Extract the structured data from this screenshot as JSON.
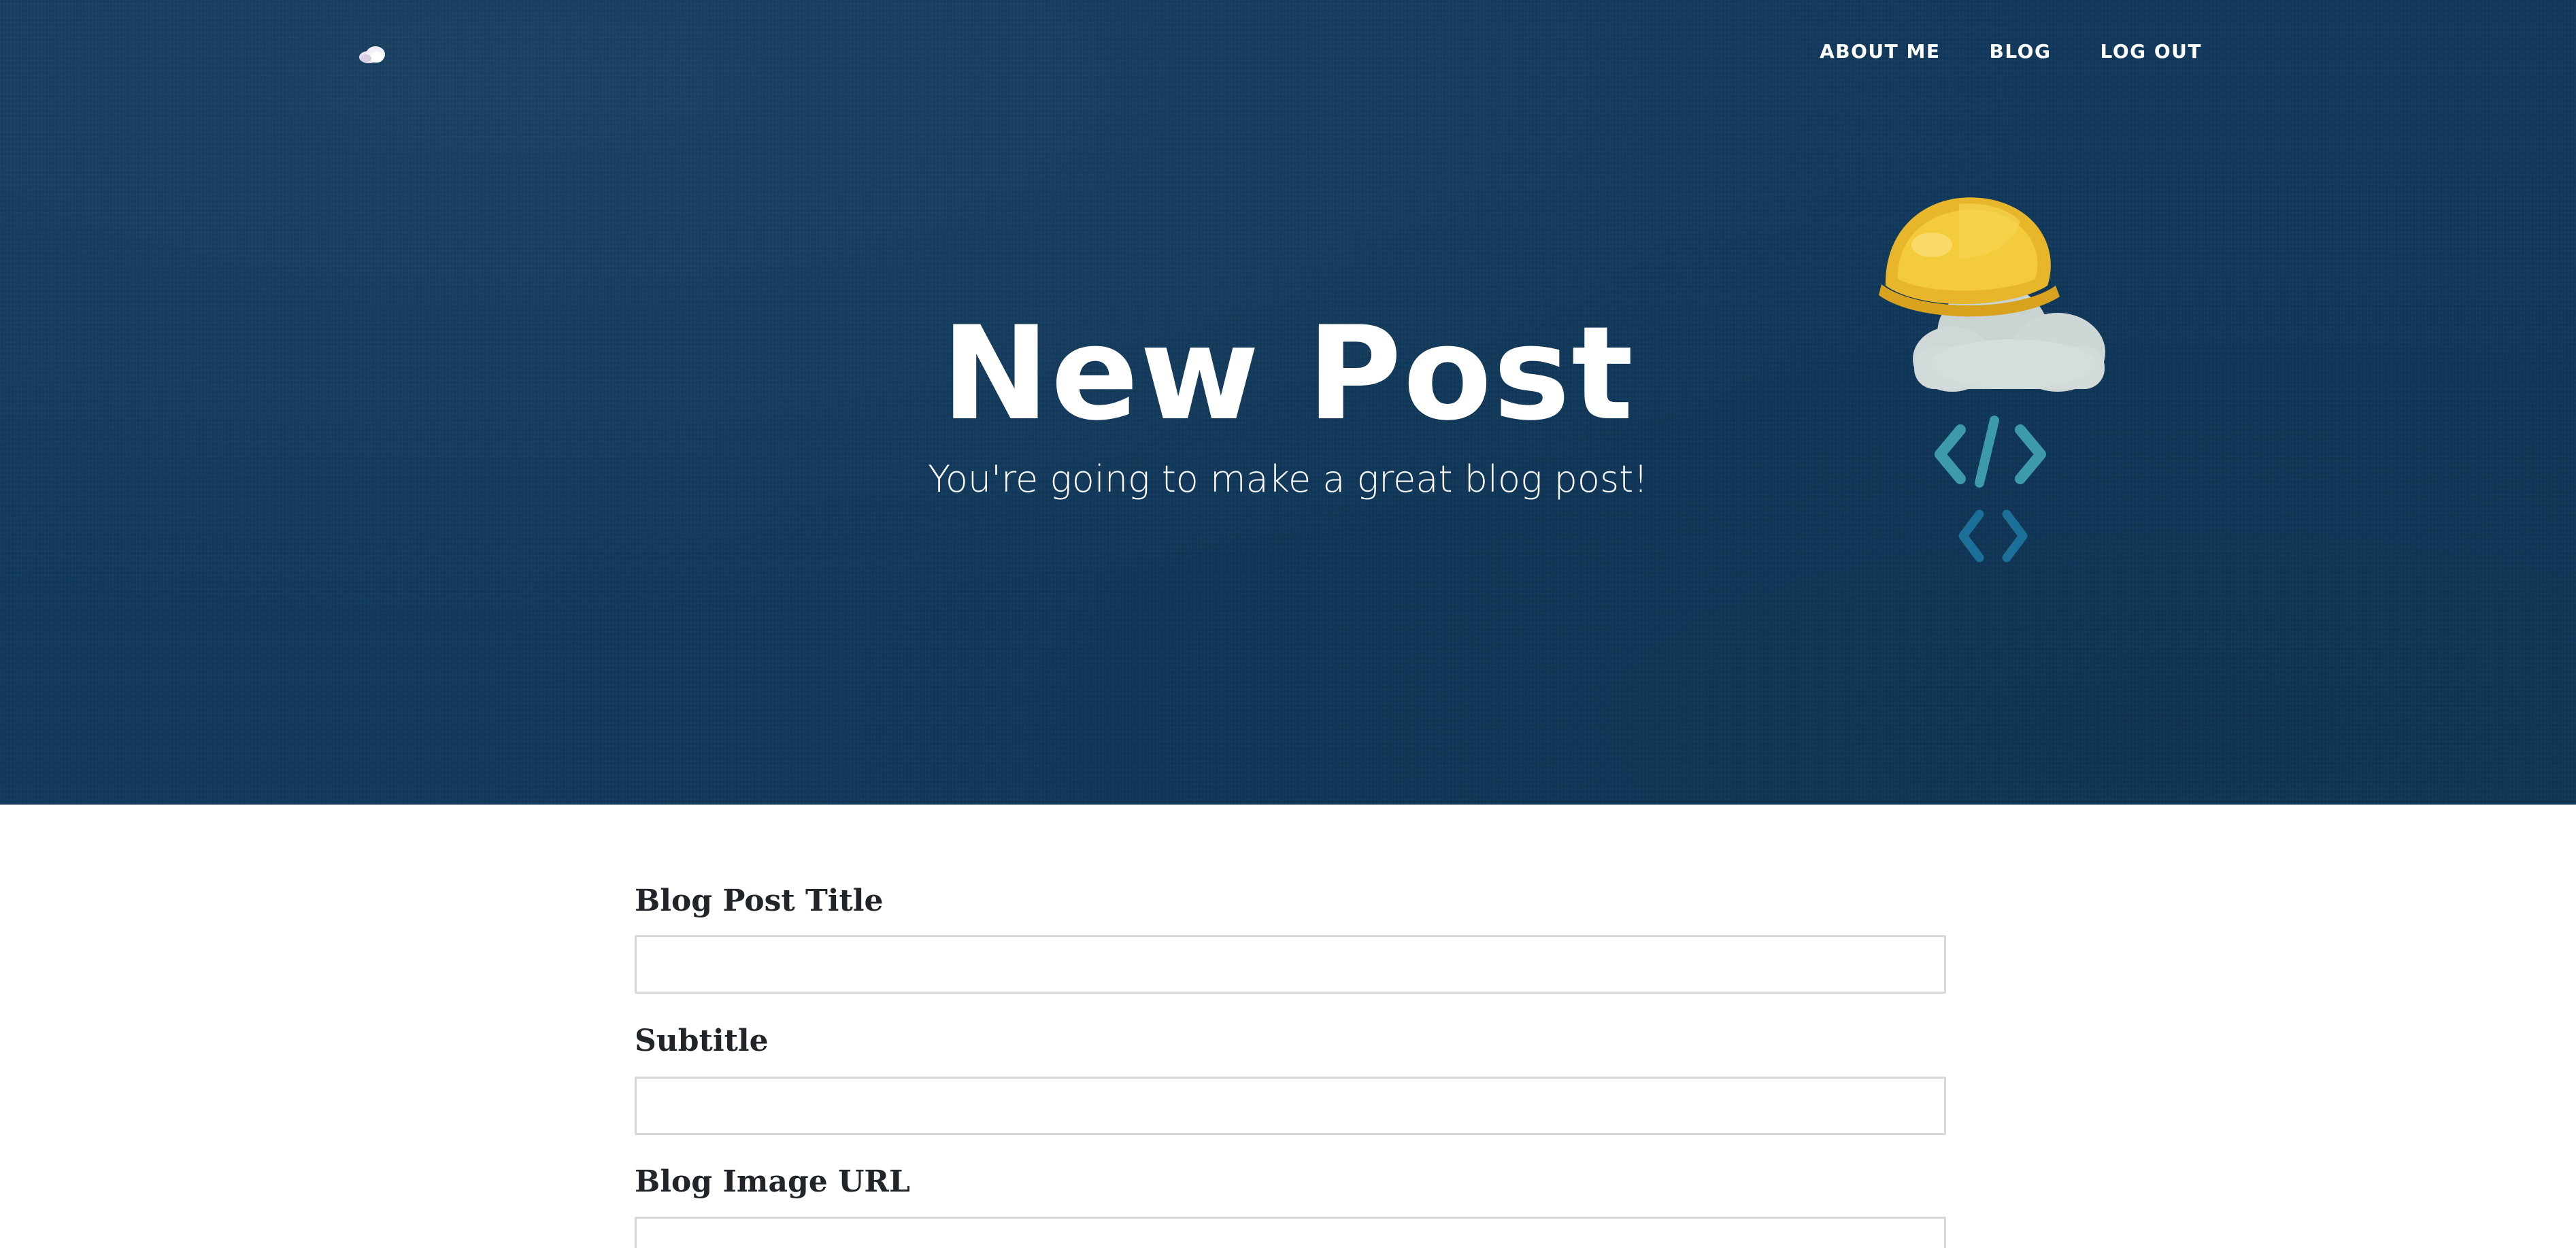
{
  "nav": {
    "logo_icon": "cloud-icon",
    "links": [
      {
        "label": "ABOUT ME"
      },
      {
        "label": "BLOG"
      },
      {
        "label": "LOG OUT"
      }
    ]
  },
  "hero": {
    "title": "New Post",
    "subtitle": "You're going to make a great blog post!",
    "illustration_icon": "cloud-hardhat-code-icon",
    "background_color": "#10395c"
  },
  "form": {
    "fields": [
      {
        "label": "Blog Post Title",
        "value": "",
        "placeholder": ""
      },
      {
        "label": "Subtitle",
        "value": "",
        "placeholder": ""
      },
      {
        "label": "Blog Image URL",
        "value": "",
        "placeholder": ""
      }
    ]
  }
}
